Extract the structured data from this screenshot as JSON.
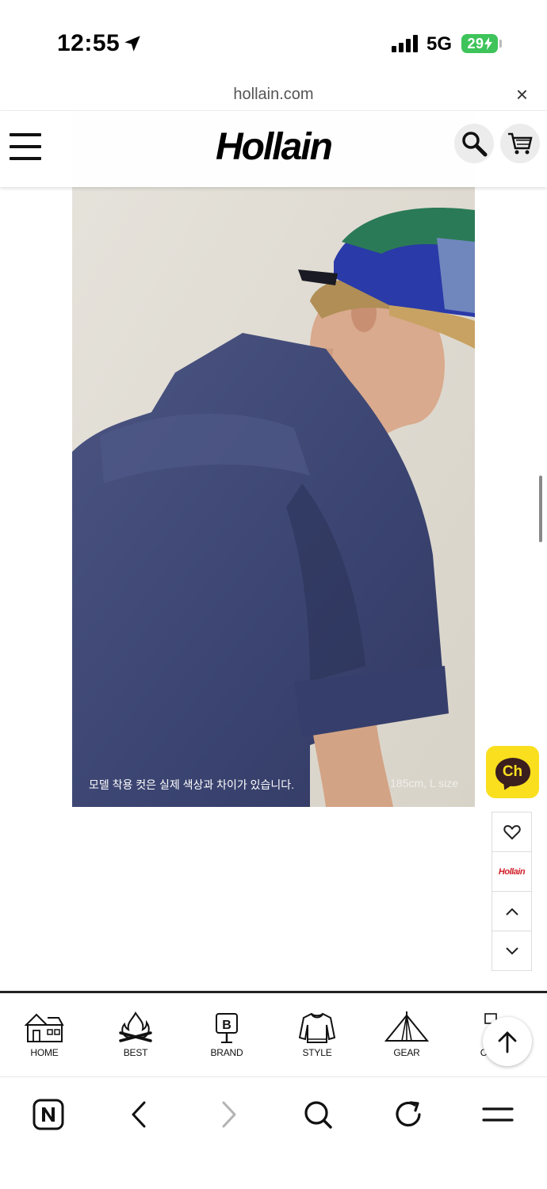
{
  "status_bar": {
    "time": "12:55",
    "network": "5G",
    "battery": "29"
  },
  "url_bar": {
    "domain": "hollain.com",
    "close_symbol": "×"
  },
  "header": {
    "logo": "Hollain"
  },
  "photo": {
    "caption": "모델 착용 컷은 실제 색상과 차이가 있습니다.",
    "size_info": "185cm, L size"
  },
  "floating": {
    "kakao_label": "Ch",
    "brand_badge": "Hollain"
  },
  "category_nav": {
    "items": [
      {
        "label": "HOME",
        "icon": "house-icon"
      },
      {
        "label": "BEST",
        "icon": "campfire-icon"
      },
      {
        "label": "BRAND",
        "icon": "signpost-icon"
      },
      {
        "label": "STYLE",
        "icon": "sweater-icon"
      },
      {
        "label": "GEAR",
        "icon": "tent-icon"
      },
      {
        "label": "C",
        "icon": "cart-icon"
      }
    ]
  },
  "browser_toolbar": {
    "icons": [
      "naver-icon",
      "back-icon",
      "forward-icon",
      "search-icon",
      "refresh-icon",
      "menu-icon"
    ]
  }
}
